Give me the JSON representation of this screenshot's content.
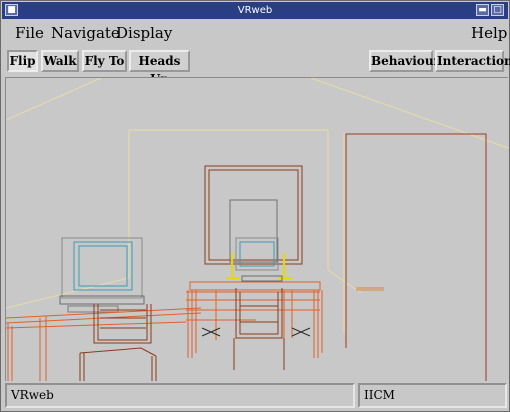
{
  "window": {
    "title": "VRweb",
    "controls": [
      "minimize-icon",
      "maximize-icon",
      "close-icon"
    ]
  },
  "menu": {
    "file": "File",
    "navigate": "Navigate",
    "display": "Display",
    "help": "Help"
  },
  "toolbar": {
    "flip": "Flip",
    "walk": "Walk",
    "fly_to": "Fly To",
    "heads_up": "Heads Up",
    "behaviour": "Behaviour",
    "interaction": "Interaction",
    "selected_mode": "Flip"
  },
  "scene": {
    "description_icons": [
      "desk-icon",
      "chair-icon",
      "monitor-icon",
      "door-icon",
      "whiteboard-icon"
    ],
    "colors": {
      "wall_lines": "#e8dca6",
      "desk": "#e0612a",
      "dark_furniture": "#8a3a1a",
      "monitor": "#3a9ab0",
      "yellow_accent": "#e6d800",
      "door": "#9a3a20"
    }
  },
  "status": {
    "left": "VRweb",
    "right": "IICM"
  }
}
